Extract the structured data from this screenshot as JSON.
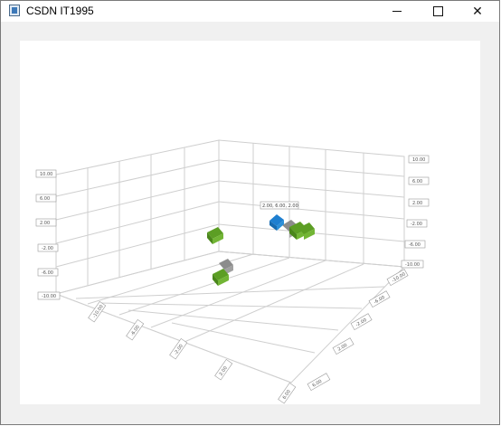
{
  "window": {
    "title": "CSDN IT1995"
  },
  "chart_data": {
    "type": "scatter3d",
    "selected_label": "2.00, 6.00, 2.00",
    "y_axis_ticks": [
      "10.00",
      "6.00",
      "2.00",
      "-2.00",
      "-6.00",
      "-10.00"
    ],
    "x_axis_ticks": [
      "-10.00",
      "-6.00",
      "-2.00",
      "2.00",
      "6.00",
      "10.00"
    ],
    "z_axis_ticks": [
      "-10.00",
      "-6.00",
      "-2.00",
      "2.00",
      "6.00",
      "10.00"
    ],
    "series_colors": {
      "default": "#6aaa2a",
      "selected": "#2b8fd8",
      "secondary": "#8c8c8c"
    }
  }
}
